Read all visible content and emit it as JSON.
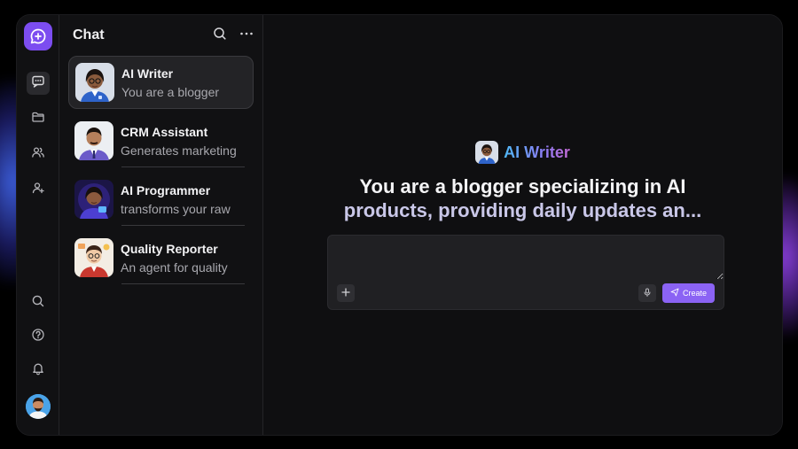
{
  "window": {
    "accent": "#7c4df0"
  },
  "rail": {
    "logo": "chat-plus-logo",
    "items": [
      {
        "icon": "chat-icon",
        "active": true
      },
      {
        "icon": "folder-icon",
        "active": false
      },
      {
        "icon": "users-icon",
        "active": false
      },
      {
        "icon": "add-user-icon",
        "active": false
      }
    ],
    "bottom": [
      {
        "icon": "search-icon"
      },
      {
        "icon": "help-icon"
      },
      {
        "icon": "bell-icon"
      }
    ]
  },
  "chat_list": {
    "title": "Chat",
    "items": [
      {
        "name": "AI Writer",
        "desc": "You are a blogger",
        "selected": true
      },
      {
        "name": "CRM Assistant",
        "desc": "Generates marketing",
        "selected": false
      },
      {
        "name": "AI Programmer",
        "desc": "transforms your raw",
        "selected": false
      },
      {
        "name": "Quality Reporter",
        "desc": "An agent for quality",
        "selected": false
      }
    ]
  },
  "main": {
    "agent_name": "AI Writer",
    "headline_line1": "You are a blogger specializing in AI",
    "headline_line2": "products, providing daily updates an...",
    "input_value": "",
    "create_label": "Create"
  }
}
